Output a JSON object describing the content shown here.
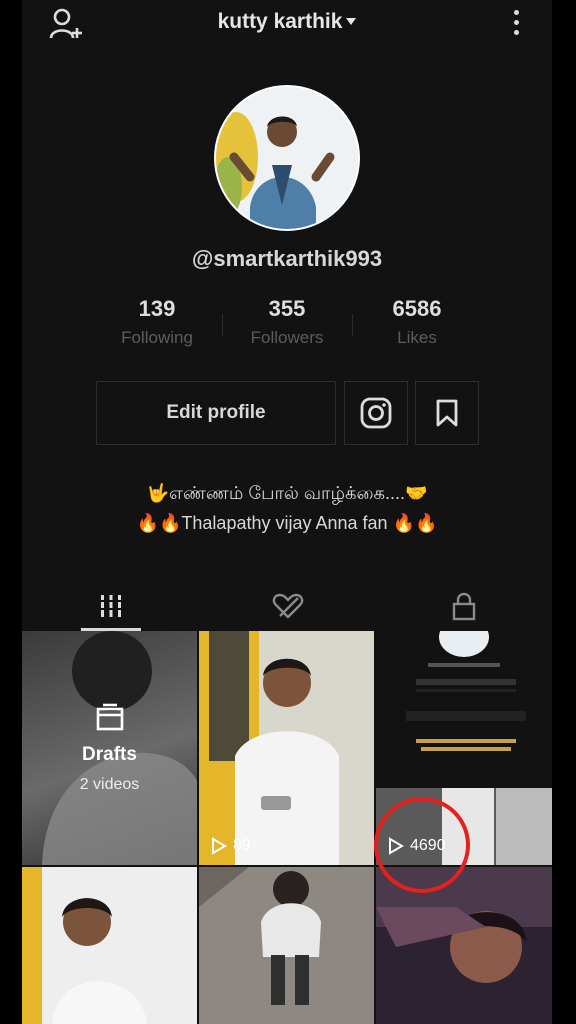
{
  "header": {
    "title": "kutty karthik",
    "add_user_icon": "add-user-icon",
    "more_icon": "more-vertical-icon"
  },
  "profile": {
    "username": "@smartkarthik993",
    "stats": [
      {
        "value": "139",
        "label": "Following"
      },
      {
        "value": "355",
        "label": "Followers"
      },
      {
        "value": "6586",
        "label": "Likes"
      }
    ],
    "edit_label": "Edit profile",
    "bio_line1": "🤟எண்ணம் போல் வாழ்க்கை....🤝",
    "bio_line2": "🔥🔥Thalapathy vijay Anna fan 🔥🔥"
  },
  "tabs": [
    {
      "icon": "grid-icon",
      "active": true
    },
    {
      "icon": "liked-hidden-icon",
      "active": false
    },
    {
      "icon": "lock-icon",
      "active": false
    }
  ],
  "grid": {
    "drafts_title": "Drafts",
    "drafts_sub": "2 videos",
    "items": [
      {
        "views": "89"
      },
      {
        "views": "4690"
      }
    ]
  },
  "colors": {
    "background": "#121212",
    "highlight_circle": "#e5201e"
  }
}
